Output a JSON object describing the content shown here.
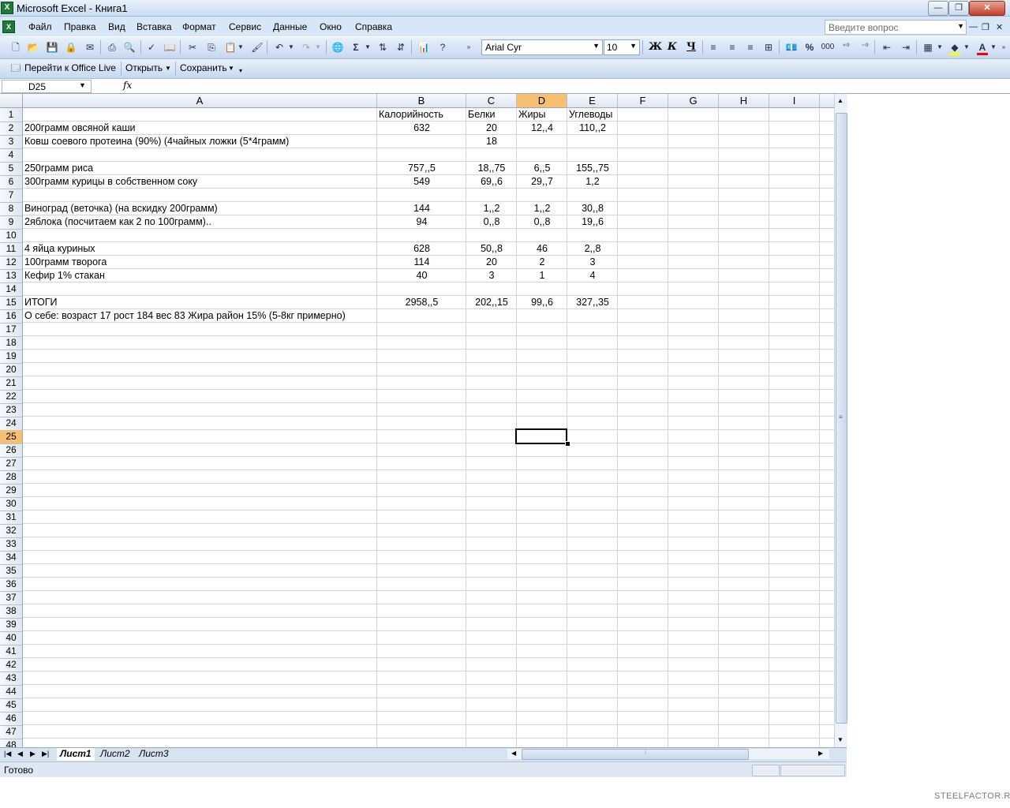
{
  "window": {
    "title": "Microsoft Excel - Книга1",
    "app_icon_glyph": "X",
    "controls": {
      "minimize": "—",
      "maximize": "❐",
      "close": "✕"
    }
  },
  "menu": {
    "items": [
      "Файл",
      "Правка",
      "Вид",
      "Вставка",
      "Формат",
      "Сервис",
      "Данные",
      "Окно",
      "Справка"
    ],
    "help_placeholder": "Введите вопрос",
    "mdi_controls": [
      "▾",
      "—",
      "❐",
      "✕"
    ]
  },
  "toolbar": {
    "font_name": "Arial Cyr",
    "font_size": "10",
    "bold_label": "Ж",
    "italic_label": "К",
    "underline_label": "Ч",
    "percent_label": "%",
    "thousands_label": "000",
    "sum_label": "Σ",
    "colors": {
      "fill": "#ffff00",
      "font": "#ff0000"
    }
  },
  "toolbar2": {
    "office_live": "Перейти к Office Live",
    "open": "Открыть",
    "save": "Сохранить"
  },
  "formula_bar": {
    "name_box": "D25",
    "fx": "fx",
    "value": ""
  },
  "grid": {
    "columns": [
      "A",
      "B",
      "C",
      "D",
      "E",
      "F",
      "G",
      "H",
      "I"
    ],
    "active_column": "D",
    "active_row": 25,
    "row_count": 48,
    "rows": [
      {
        "r": 1,
        "A": "",
        "B": "Калорийность",
        "C": "Белки",
        "D": "Жиры",
        "E": "Углеводы"
      },
      {
        "r": 2,
        "A": "200грамм овсяной каши",
        "B": "632",
        "C": "20",
        "D": "12,,4",
        "E": "110,,2"
      },
      {
        "r": 3,
        "A": "Ковш соевого протеина (90%) (4чайных ложки (5*4грамм)",
        "B": "",
        "C": "18",
        "D": "",
        "E": ""
      },
      {
        "r": 5,
        "A": "250грамм риса",
        "B": "757,,5",
        "C": "18,,75",
        "D": "6,,5",
        "E": "155,,75"
      },
      {
        "r": 6,
        "A": "300грамм курицы в собственном соку",
        "B": "549",
        "C": "69,,6",
        "D": "29,,7",
        "E": "1,2"
      },
      {
        "r": 8,
        "A": "Виноград (веточка) (на вскидку 200грамм)",
        "B": "144",
        "C": "1,,2",
        "D": "1,,2",
        "E": "30,,8"
      },
      {
        "r": 9,
        "A": "2яблока (посчитаем как 2 по 100грамм)..",
        "B": "94",
        "C": "0,,8",
        "D": "0,,8",
        "E": "19,,6"
      },
      {
        "r": 11,
        "A": "4 яйца куриных",
        "B": "628",
        "C": "50,,8",
        "D": "46",
        "E": "2,,8"
      },
      {
        "r": 12,
        "A": "100грамм творога",
        "B": "114",
        "C": "20",
        "D": "2",
        "E": "3"
      },
      {
        "r": 13,
        "A": "Кефир 1% стакан",
        "B": "40",
        "C": "3",
        "D": "1",
        "E": "4"
      },
      {
        "r": 15,
        "A": "ИТОГИ",
        "B": "2958,,5",
        "C": "202,,15",
        "D": "99,,6",
        "E": "327,,35"
      },
      {
        "r": 16,
        "A": "О себе: возраст 17 рост 184 вес 83 Жира район 15% (5-8кг примерно)",
        "B": "",
        "C": "",
        "D": "",
        "E": ""
      }
    ]
  },
  "sheets": [
    "Лист1",
    "Лист2",
    "Лист3"
  ],
  "active_sheet": "Лист1",
  "status": {
    "text": "Готово"
  },
  "watermark": "STEELFACTOR.RU"
}
